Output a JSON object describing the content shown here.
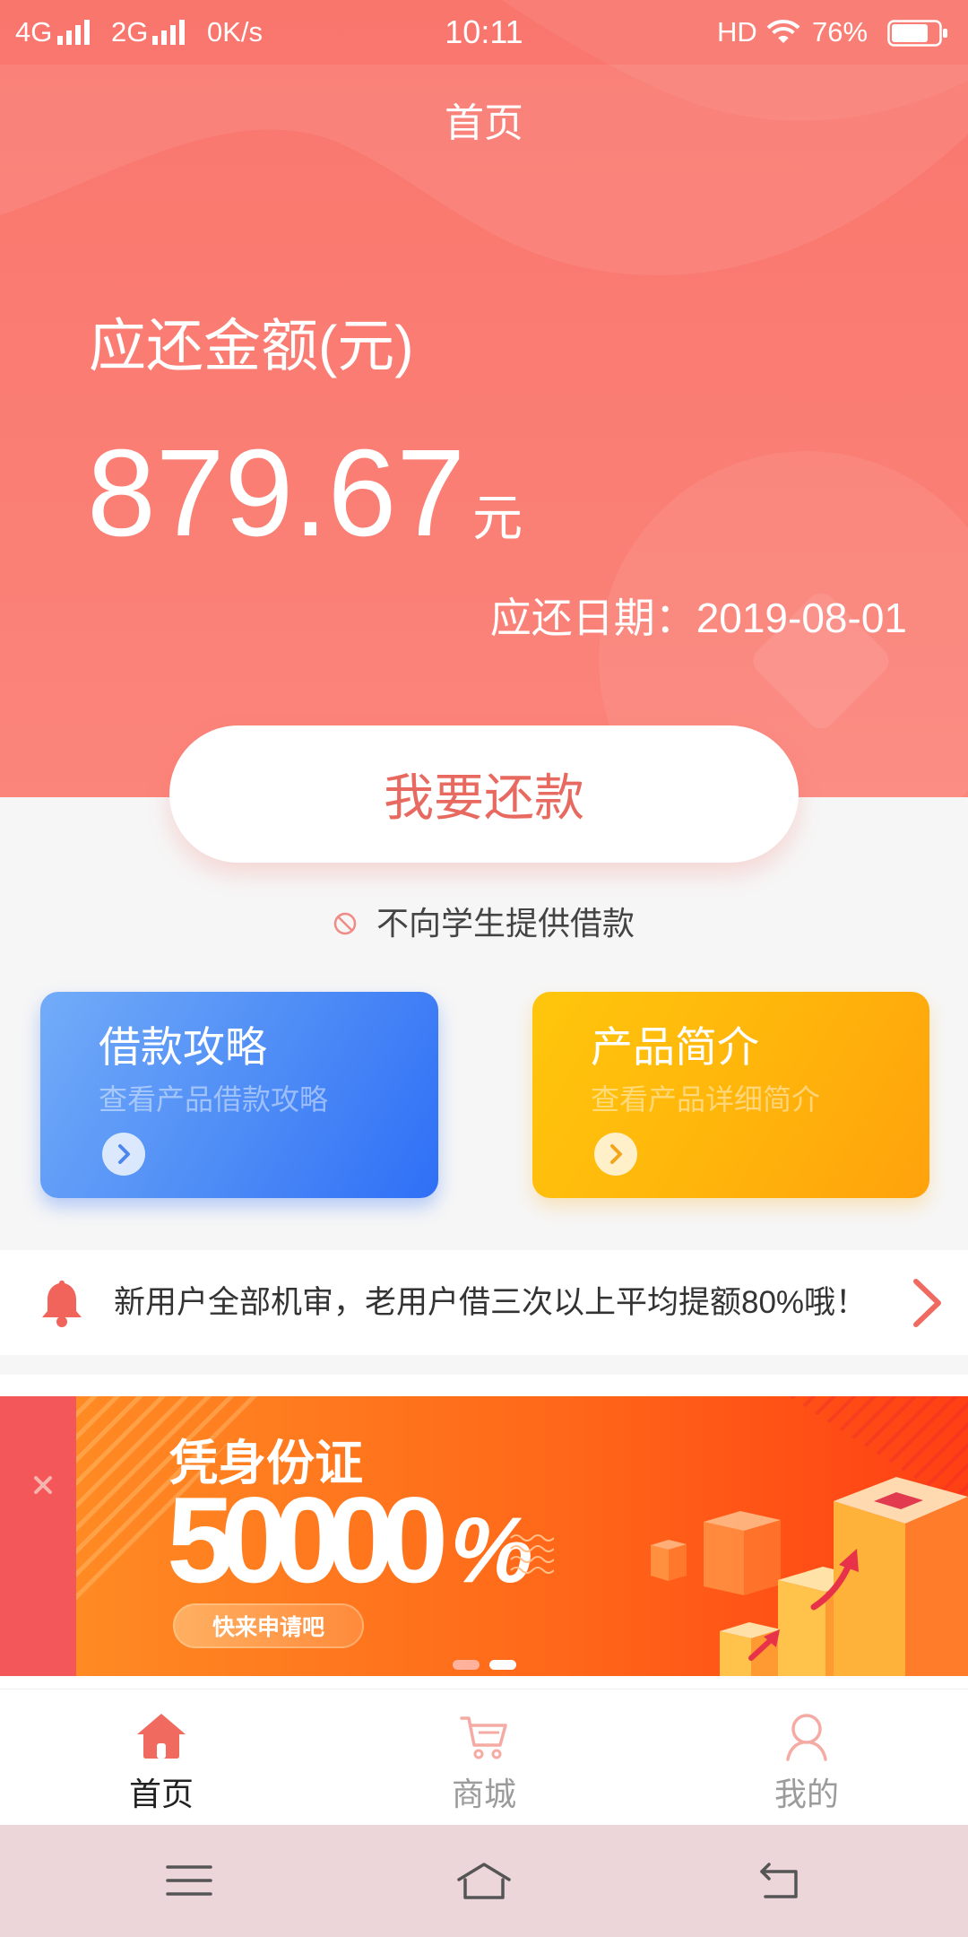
{
  "status_bar": {
    "network_1": "4G",
    "network_2": "2G",
    "speed": "0K/s",
    "time": "10:11",
    "hd": "HD",
    "battery": "76%",
    "icons": [
      "signal-icon",
      "signal-icon",
      "wifi-icon",
      "battery-icon"
    ]
  },
  "header": {
    "title": "首页"
  },
  "repayment": {
    "amount_label": "应还金额(元)",
    "amount": "879.67",
    "unit": "元",
    "due_label": "应还日期：",
    "due_date": "2019-08-01",
    "button_label": "我要还款"
  },
  "student_notice": {
    "icon": "prohibited-icon",
    "text": "不向学生提供借款"
  },
  "cards": [
    {
      "title": "借款攻略",
      "subtitle": "查看产品借款攻略",
      "icon": "chevron-right-icon",
      "color": "#4d8bf6"
    },
    {
      "title": "产品简介",
      "subtitle": "查看产品详细简介",
      "icon": "chevron-right-icon",
      "color": "#ffb40b"
    }
  ],
  "announcement": {
    "icon": "bell-icon",
    "text": "新用户全部机审，老用户借三次以上平均提额80%哦！",
    "more_icon": "chevron-right-icon"
  },
  "banner": {
    "close_icon": "close-icon",
    "headline": "凭身份证",
    "amount": "50000",
    "amount_suffix": "%",
    "cta": "快来申请吧",
    "slide_count": 2,
    "active_slide": 2
  },
  "tab_bar": {
    "tabs": [
      {
        "label": "首页",
        "icon": "home-icon",
        "active": true
      },
      {
        "label": "商城",
        "icon": "cart-icon",
        "active": false
      },
      {
        "label": "我的",
        "icon": "user-icon",
        "active": false
      }
    ]
  },
  "system_nav": {
    "icons": [
      "menu-icon",
      "home-outline-icon",
      "back-icon"
    ]
  },
  "colors": {
    "hero": "#f9786f",
    "button_text": "#e8695f",
    "tab_active_icon": "#f06a5f",
    "tab_inactive_icon": "#f5aba4",
    "tab_inactive_text": "#9b9b9b",
    "system_nav_bg": "#ecd6d9"
  }
}
